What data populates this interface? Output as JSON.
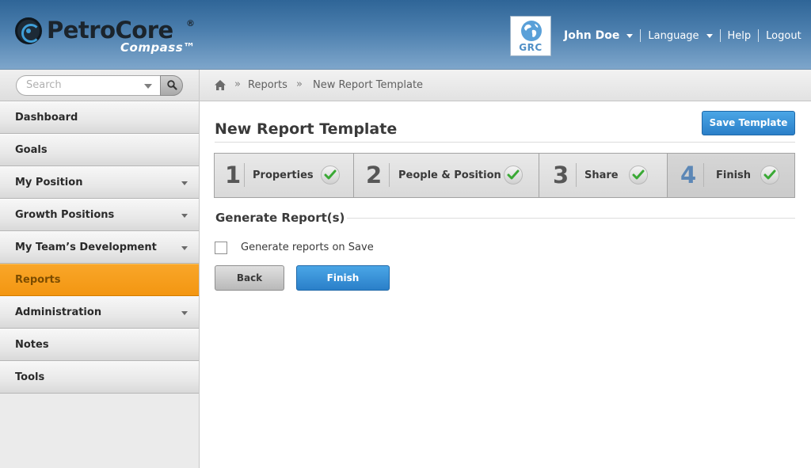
{
  "header": {
    "logo_name": "PetroCore",
    "logo_registered": "®",
    "logo_sub": "Compass™",
    "badge_text": "GRC",
    "user_name": "John Doe",
    "language_label": "Language",
    "help_label": "Help",
    "logout_label": "Logout"
  },
  "search": {
    "placeholder": "Search"
  },
  "sidebar": {
    "items": [
      {
        "label": "Dashboard"
      },
      {
        "label": "Goals"
      },
      {
        "label": "My Position"
      },
      {
        "label": "Growth Positions"
      },
      {
        "label": "My Team’s Development"
      },
      {
        "label": "Reports"
      },
      {
        "label": "Administration"
      },
      {
        "label": "Notes"
      },
      {
        "label": "Tools"
      }
    ]
  },
  "breadcrumb": {
    "separator": "»",
    "items": [
      "Reports",
      "New Report Template"
    ]
  },
  "main": {
    "title": "New Report Template",
    "save_template_label": "Save Template",
    "steps": [
      {
        "number": "1",
        "label": "Properties"
      },
      {
        "number": "2",
        "label": "People & Position"
      },
      {
        "number": "3",
        "label": "Share"
      },
      {
        "number": "4",
        "label": "Finish"
      }
    ],
    "section_title": "Generate Report(s)",
    "checkbox_label": "Generate reports on Save",
    "back_label": "Back",
    "finish_label": "Finish"
  },
  "colors": {
    "header_blue": "#3f74a6",
    "active_orange": "#f5a020",
    "primary_button": "#2f8bd6",
    "check_green": "#3aa935"
  }
}
